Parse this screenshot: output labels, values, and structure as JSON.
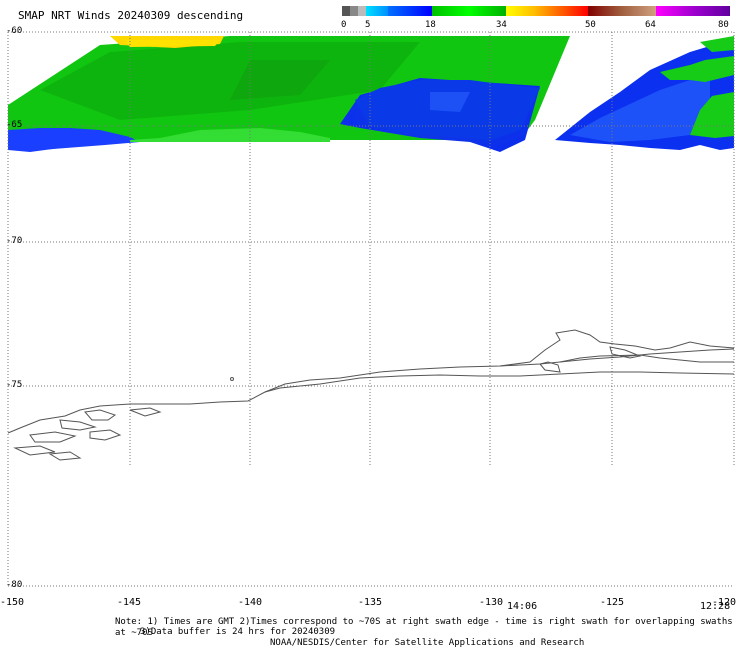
{
  "title": "SMAP NRT Winds  20240309 descending",
  "colorbar": {
    "labels": [
      "0",
      "5",
      "18",
      "34",
      "50",
      "64",
      "80"
    ],
    "colors": [
      "#555555",
      "#808080",
      "#bdbdbd",
      "#00d0ff",
      "#0080ff",
      "#0000ff",
      "#00c000",
      "#00ff00",
      "#ffff00",
      "#ff8000",
      "#ff0000",
      "#a05020",
      "#c0a080",
      "#ff00ff",
      "#8000c0"
    ]
  },
  "map": {
    "lat_labels": [
      "-60",
      "-65",
      "-70",
      "-75",
      "-80"
    ],
    "lon_labels": [
      "-150",
      "-145",
      "-140",
      "-135",
      "-130",
      "-125",
      "-120"
    ],
    "time_labels": [
      "14:06",
      "12:28"
    ]
  },
  "notes": {
    "line1": "Note: 1) Times are GMT 2)Times correspond to ~70S at right swath edge - time is right swath for overlapping swaths at ~70S",
    "line2": "3)Data buffer is 24 hrs for 20240309",
    "line3": "NOAA/NESDIS/Center for Satellite Applications and Research"
  }
}
